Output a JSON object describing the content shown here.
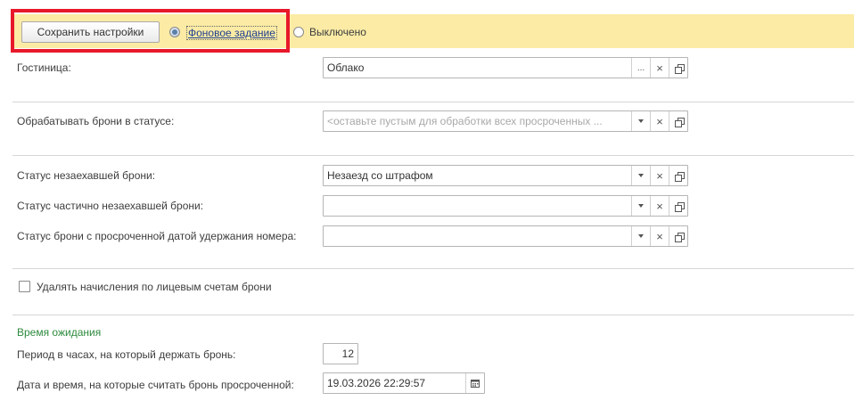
{
  "toolbar": {
    "save_label": "Сохранить настройки",
    "background_job_link": "Фоновое задание",
    "disabled_label": "Выключено"
  },
  "hotel": {
    "label": "Гостиница:",
    "value": "Облако"
  },
  "process_status": {
    "label": "Обрабатывать брони в статусе:",
    "placeholder": "<оставьте пустым для обработки всех просроченных ..."
  },
  "no_show_status": {
    "label": "Статус незаехавшей брони:",
    "value": "Незаезд со штрафом"
  },
  "partial_no_show_status": {
    "label": "Статус частично незаехавшей брони:",
    "value": ""
  },
  "expired_hold_status": {
    "label": "Статус брони с просроченной датой удержания номера:",
    "value": ""
  },
  "delete_charges": {
    "label": "Удалять начисления по лицевым счетам брони",
    "checked": false
  },
  "wait_section": {
    "title": "Время ожидания",
    "hold_period_label": "Период в часах, на который держать бронь:",
    "hold_period_value": "12",
    "expired_datetime_label": "Дата и время, на которые считать бронь просроченной:",
    "expired_datetime_value": "19.03.2026 22:29:57"
  },
  "icons": {
    "more": "...",
    "clear": "×",
    "dropdown": "chevron-down-icon",
    "open": "copy-icon",
    "calendar": "calendar-icon"
  },
  "colors": {
    "toolbar_bg": "#fbeba5",
    "highlight": "#e8182b",
    "section_title": "#2e8b3e",
    "link": "#1f3f8f"
  }
}
